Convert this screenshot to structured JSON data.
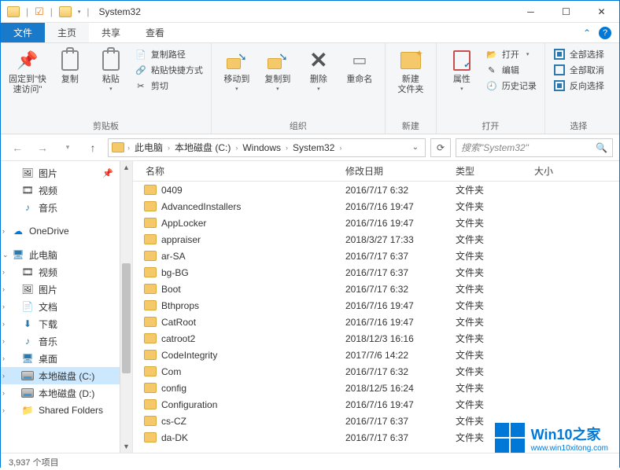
{
  "window": {
    "title": "System32"
  },
  "tabs": {
    "file": "文件",
    "home": "主页",
    "share": "共享",
    "view": "查看"
  },
  "ribbon": {
    "pin": "固定到\"快\n速访问\"",
    "copy": "复制",
    "paste": "粘贴",
    "copy_path": "复制路径",
    "paste_shortcut": "粘贴快捷方式",
    "cut": "剪切",
    "group_clipboard": "剪贴板",
    "move_to": "移动到",
    "copy_to": "复制到",
    "delete": "删除",
    "rename": "重命名",
    "group_organize": "组织",
    "new_folder": "新建\n文件夹",
    "group_new": "新建",
    "properties": "属性",
    "open": "打开",
    "edit": "编辑",
    "history": "历史记录",
    "group_open": "打开",
    "select_all": "全部选择",
    "select_none": "全部取消",
    "invert_sel": "反向选择",
    "group_select": "选择"
  },
  "breadcrumbs": [
    "此电脑",
    "本地磁盘 (C:)",
    "Windows",
    "System32"
  ],
  "search_placeholder": "搜索\"System32\"",
  "nav": {
    "pictures": "图片",
    "videos": "视频",
    "music": "音乐",
    "onedrive": "OneDrive",
    "this_pc": "此电脑",
    "videos2": "视频",
    "pictures2": "图片",
    "documents": "文档",
    "downloads": "下载",
    "music2": "音乐",
    "desktop": "桌面",
    "drive_c": "本地磁盘 (C:)",
    "drive_d": "本地磁盘 (D:)",
    "shared": "Shared Folders"
  },
  "columns": {
    "name": "名称",
    "date": "修改日期",
    "type": "类型",
    "size": "大小"
  },
  "type_folder": "文件夹",
  "files": [
    {
      "name": "0409",
      "date": "2016/7/17 6:32"
    },
    {
      "name": "AdvancedInstallers",
      "date": "2016/7/16 19:47"
    },
    {
      "name": "AppLocker",
      "date": "2016/7/16 19:47"
    },
    {
      "name": "appraiser",
      "date": "2018/3/27 17:33"
    },
    {
      "name": "ar-SA",
      "date": "2016/7/17 6:37"
    },
    {
      "name": "bg-BG",
      "date": "2016/7/17 6:37"
    },
    {
      "name": "Boot",
      "date": "2016/7/17 6:32"
    },
    {
      "name": "Bthprops",
      "date": "2016/7/16 19:47"
    },
    {
      "name": "CatRoot",
      "date": "2016/7/16 19:47"
    },
    {
      "name": "catroot2",
      "date": "2018/12/3 16:16"
    },
    {
      "name": "CodeIntegrity",
      "date": "2017/7/6 14:22"
    },
    {
      "name": "Com",
      "date": "2016/7/17 6:32"
    },
    {
      "name": "config",
      "date": "2018/12/5 16:24"
    },
    {
      "name": "Configuration",
      "date": "2016/7/16 19:47"
    },
    {
      "name": "cs-CZ",
      "date": "2016/7/17 6:37"
    },
    {
      "name": "da-DK",
      "date": "2016/7/17 6:37"
    }
  ],
  "status": "3,937 个项目",
  "watermark": {
    "t1": "Win10之家",
    "t2": "www.win10xitong.com"
  }
}
